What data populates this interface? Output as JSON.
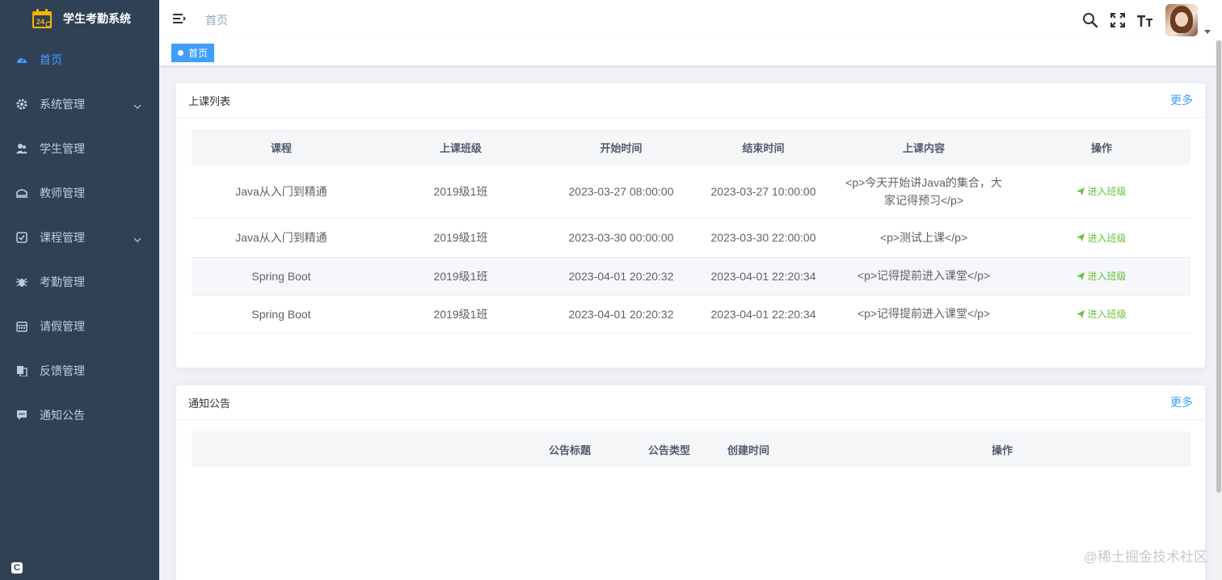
{
  "app": {
    "title": "学生考勤系统"
  },
  "sidebar": {
    "items": [
      {
        "label": "首页",
        "icon": "dashboard-icon",
        "active": true,
        "has_children": false
      },
      {
        "label": "系统管理",
        "icon": "gear-icon",
        "active": false,
        "has_children": true
      },
      {
        "label": "学生管理",
        "icon": "user-icon",
        "active": false,
        "has_children": false
      },
      {
        "label": "教师管理",
        "icon": "teacher-icon",
        "active": false,
        "has_children": false
      },
      {
        "label": "课程管理",
        "icon": "checkbox-icon",
        "active": false,
        "has_children": true
      },
      {
        "label": "考勤管理",
        "icon": "bug-icon",
        "active": false,
        "has_children": false
      },
      {
        "label": "请假管理",
        "icon": "calendar-icon",
        "active": false,
        "has_children": false
      },
      {
        "label": "反馈管理",
        "icon": "documents-icon",
        "active": false,
        "has_children": false
      },
      {
        "label": "通知公告",
        "icon": "message-icon",
        "active": false,
        "has_children": false
      }
    ]
  },
  "navbar": {
    "breadcrumb": "首页",
    "icons": [
      "search-icon",
      "fullscreen-icon",
      "font-size-icon"
    ]
  },
  "tags_view": {
    "active_tag": "首页"
  },
  "class_card": {
    "title": "上课列表",
    "more": "更多",
    "columns": [
      "课程",
      "上课班级",
      "开始时间",
      "结束时间",
      "上课内容",
      "操作"
    ],
    "rows": [
      {
        "course": "Java从入门到精通",
        "class": "2019级1班",
        "start": "2023-03-27 08:00:00",
        "end": "2023-03-27 10:00:00",
        "content_line1": "<p>今天开始讲Java的集合，大",
        "content_line2": "家记得预习</p>",
        "action": "进入班级"
      },
      {
        "course": "Java从入门到精通",
        "class": "2019级1班",
        "start": "2023-03-30 00:00:00",
        "end": "2023-03-30 22:00:00",
        "content_line1": "<p>测试上课</p>",
        "content_line2": "",
        "action": "进入班级"
      },
      {
        "course": "Spring Boot",
        "class": "2019级1班",
        "start": "2023-04-01 20:20:32",
        "end": "2023-04-01 22:20:34",
        "content_line1": "<p>记得提前进入课堂</p>",
        "content_line2": "",
        "action": "进入班级"
      },
      {
        "course": "Spring Boot",
        "class": "2019级1班",
        "start": "2023-04-01 20:20:32",
        "end": "2023-04-01 22:20:34",
        "content_line1": "<p>记得提前进入课堂</p>",
        "content_line2": "",
        "action": "进入班级"
      }
    ]
  },
  "notice_card": {
    "title": "通知公告",
    "more": "更多",
    "columns": [
      "公告标题",
      "公告类型",
      "创建时间",
      "操作"
    ]
  },
  "sidebar_bottom": {
    "label": "C"
  },
  "watermark": "@稀土掘金技术社区",
  "colors": {
    "sidebar_bg": "#304156",
    "accent": "#409eff",
    "action": "#67c23a"
  }
}
